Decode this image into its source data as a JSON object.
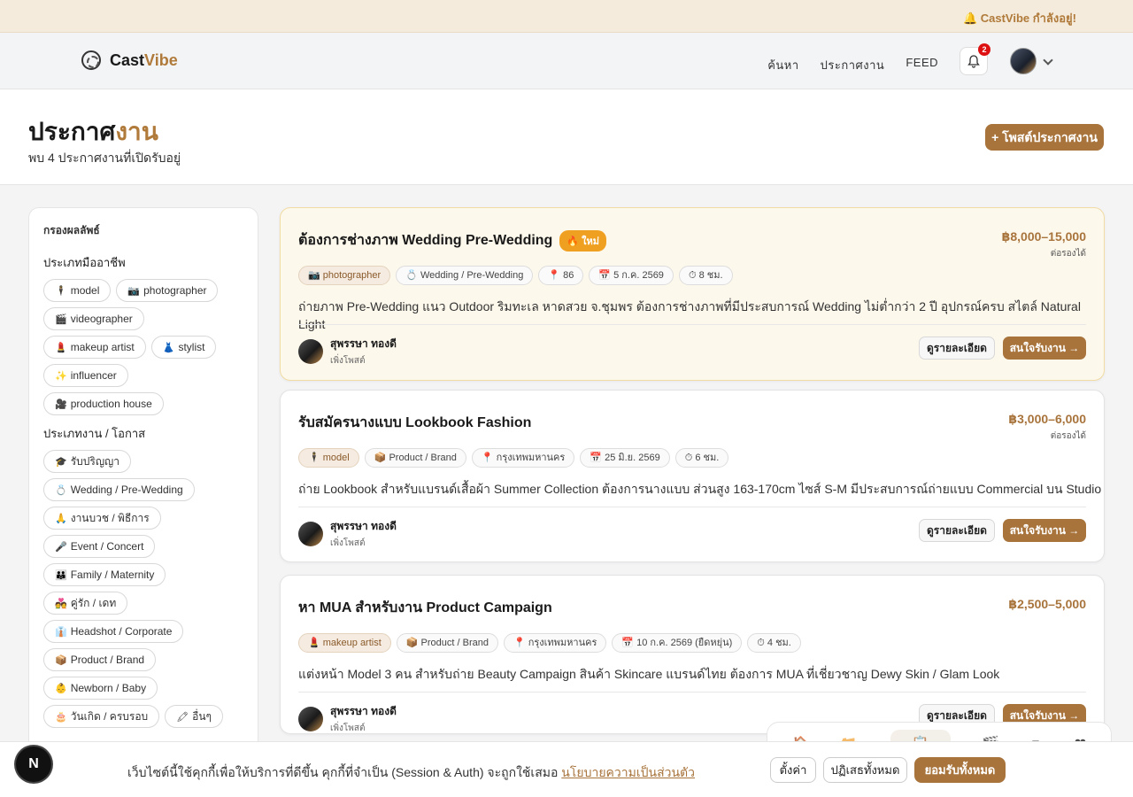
{
  "topbar": {
    "live_text": "🔔 CastVibe กำลังอยู่!"
  },
  "header": {
    "logo_cast": "Cast",
    "logo_vibe": "Vibe",
    "nav": [
      "ค้นหา",
      "ประกาศงาน",
      "FEED"
    ],
    "notifications": "2"
  },
  "hero": {
    "title_part1": "ประกาศ",
    "title_part2": "งาน",
    "subtitle": "พบ 4 ประกาศงานที่เปิดรับอยู่",
    "post_button": "+ โพสต์ประกาศงาน"
  },
  "filters": {
    "title": "กรองผลลัพธ์",
    "profession_title": "ประเภทมืออาชีพ",
    "professions": [
      {
        "icon": "🕴",
        "label": "model"
      },
      {
        "icon": "📷",
        "label": "photographer"
      },
      {
        "icon": "🎬",
        "label": "videographer"
      },
      {
        "icon": "💄",
        "label": "makeup artist"
      },
      {
        "icon": "👗",
        "label": "stylist"
      },
      {
        "icon": "✨",
        "label": "influencer"
      },
      {
        "icon": "🎥",
        "label": "production house"
      }
    ],
    "jobtype_title": "ประเภทงาน / โอกาส",
    "jobtypes": [
      {
        "icon": "🎓",
        "label": "รับปริญญา"
      },
      {
        "icon": "💍",
        "label": "Wedding / Pre-Wedding"
      },
      {
        "icon": "🙏",
        "label": "งานบวช / พิธีการ"
      },
      {
        "icon": "🎤",
        "label": "Event / Concert"
      },
      {
        "icon": "👪",
        "label": "Family / Maternity"
      },
      {
        "icon": "💑",
        "label": "คู่รัก / เดท"
      },
      {
        "icon": "👔",
        "label": "Headshot / Corporate"
      },
      {
        "icon": "📦",
        "label": "Product / Brand"
      },
      {
        "icon": "👶",
        "label": "Newborn / Baby"
      },
      {
        "icon": "🎂",
        "label": "วันเกิด / ครบรอบ"
      },
      {
        "icon": "🖍",
        "label": "อื่นๆ"
      }
    ]
  },
  "jobs": [
    {
      "title": "ต้องการช่างภาพ Wedding Pre-Wedding",
      "badge": "🔥 ใหม่",
      "price": "฿8,000–15,000",
      "negotiable": "ต่อรองได้",
      "tags": [
        {
          "icon": "📷",
          "text": "photographer",
          "role": true
        },
        {
          "icon": "💍",
          "text": "Wedding / Pre-Wedding"
        },
        {
          "icon": "📍",
          "text": "86"
        },
        {
          "icon": "📅",
          "text": "5 ก.ค. 2569"
        },
        {
          "icon": "⏱",
          "text": "8 ชม."
        }
      ],
      "description": "ถ่ายภาพ Pre-Wedding แนว Outdoor ริมทะเล หาดสวย จ.ชุมพร ต้องการช่างภาพที่มีประสบการณ์ Wedding ไม่ต่ำกว่า 2 ปี อุปกรณ์ครบ สไตล์ Natural Light",
      "poster": "สุพรรษา ทองดี",
      "posted": "เพิ่งโพสต์",
      "detail": "ดูรายละเอียด",
      "apply": "สนใจรับงาน →"
    },
    {
      "title": "รับสมัครนางแบบ Lookbook Fashion",
      "badge": "",
      "price": "฿3,000–6,000",
      "negotiable": "ต่อรองได้",
      "tags": [
        {
          "icon": "🕴",
          "text": "model",
          "role": true
        },
        {
          "icon": "📦",
          "text": "Product / Brand"
        },
        {
          "icon": "📍",
          "text": "กรุงเทพมหานคร"
        },
        {
          "icon": "📅",
          "text": "25 มิ.ย. 2569"
        },
        {
          "icon": "⏱",
          "text": "6 ชม."
        }
      ],
      "description": "ถ่าย Lookbook สำหรับแบรนด์เสื้อผ้า Summer Collection ต้องการนางแบบ ส่วนสูง 163-170cm ไซส์ S-M มีประสบการณ์ถ่ายแบบ Commercial บน Studio",
      "poster": "สุพรรษา ทองดี",
      "posted": "เพิ่งโพสต์",
      "detail": "ดูรายละเอียด",
      "apply": "สนใจรับงาน →"
    },
    {
      "title": "หา MUA สำหรับงาน Product Campaign",
      "badge": "",
      "price": "฿2,500–5,000",
      "negotiable": "",
      "tags": [
        {
          "icon": "💄",
          "text": "makeup artist",
          "role": true
        },
        {
          "icon": "📦",
          "text": "Product / Brand"
        },
        {
          "icon": "📍",
          "text": "กรุงเทพมหานคร"
        },
        {
          "icon": "📅",
          "text": "10 ก.ค. 2569 (ยืดหยุ่น)"
        },
        {
          "icon": "⏱",
          "text": "4 ชม."
        }
      ],
      "description": "แต่งหน้า Model 3 คน สำหรับถ่าย Beauty Campaign สินค้า Skincare แบรนด์ไทย ต้องการ MUA ที่เชี่ยวชาญ Dewy Skin / Glam Look",
      "poster": "สุพรรษา ทองดี",
      "posted": "เพิ่งโพสต์",
      "detail": "ดูรายละเอียด",
      "apply": "สนใจรับงาน →"
    }
  ],
  "dock": {
    "icons": [
      "🏠",
      "📂",
      "📋",
      "🎬",
      "✏",
      "❤"
    ]
  },
  "cookie": {
    "text": "เว็บไซต์นี้ใช้คุกกี้เพื่อให้บริการที่ดีขึ้น คุกกี้ที่จำเป็น (Session & Auth) จะถูกใช้เสมอ ",
    "link": "นโยบายความเป็นส่วนตัว",
    "settings": "ตั้งค่า",
    "reject": "ปฏิเสธทั้งหมด",
    "accept": "ยอมรับทั้งหมด"
  },
  "n_badge": "N"
}
